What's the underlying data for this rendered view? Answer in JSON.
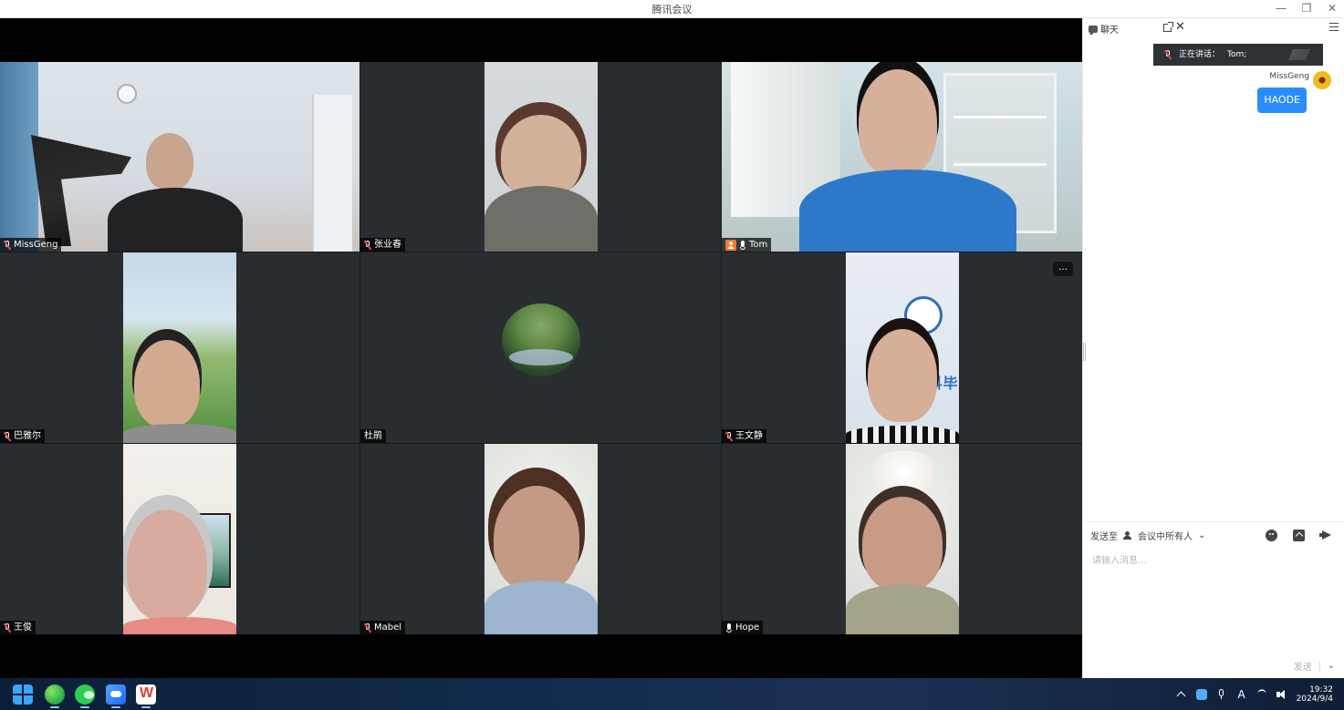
{
  "window": {
    "title": "腾讯会议",
    "minimize": "—",
    "restore": "❐",
    "close": "✕"
  },
  "participants": [
    {
      "name": "MissGeng",
      "status": "muted",
      "background": "room"
    },
    {
      "name": "张业春",
      "status": "muted",
      "background": "portrait"
    },
    {
      "name": "Tom",
      "status": "speaking",
      "host": true,
      "background": "study"
    },
    {
      "name": "巴雅尔",
      "status": "muted",
      "background": "meadow"
    },
    {
      "name": "杜鹃",
      "status": "none",
      "background": "avatar"
    },
    {
      "name": "王文静",
      "status": "muted",
      "background": "school-banner"
    },
    {
      "name": "王俊",
      "status": "muted",
      "background": "home"
    },
    {
      "name": "Mabel",
      "status": "muted",
      "background": "blur"
    },
    {
      "name": "Hope",
      "status": "mic",
      "background": "home-light"
    }
  ],
  "tile_more": "…",
  "banner": {
    "school_text": "专业本科毕"
  },
  "chat": {
    "title": "聊天",
    "close": "✕",
    "speaker_label": "正在讲话：",
    "speaker_name": "Tom;",
    "messages": [
      {
        "sender": "MissGeng",
        "text": "HAODE"
      }
    ],
    "send_to_label": "发送至",
    "recipient": "会议中所有人",
    "recipient_chevron": "⌄",
    "input_placeholder": "请输入消息...",
    "send_label": "发送",
    "send_chevron": "⌄"
  },
  "taskbar": {
    "time": "19:32",
    "date": "2024/9/4",
    "font_indicator": "A"
  },
  "colors": {
    "active_speaker": "#1cc85c",
    "chat_bubble": "#2a8cff",
    "tile_bg": "#2a2d30"
  }
}
